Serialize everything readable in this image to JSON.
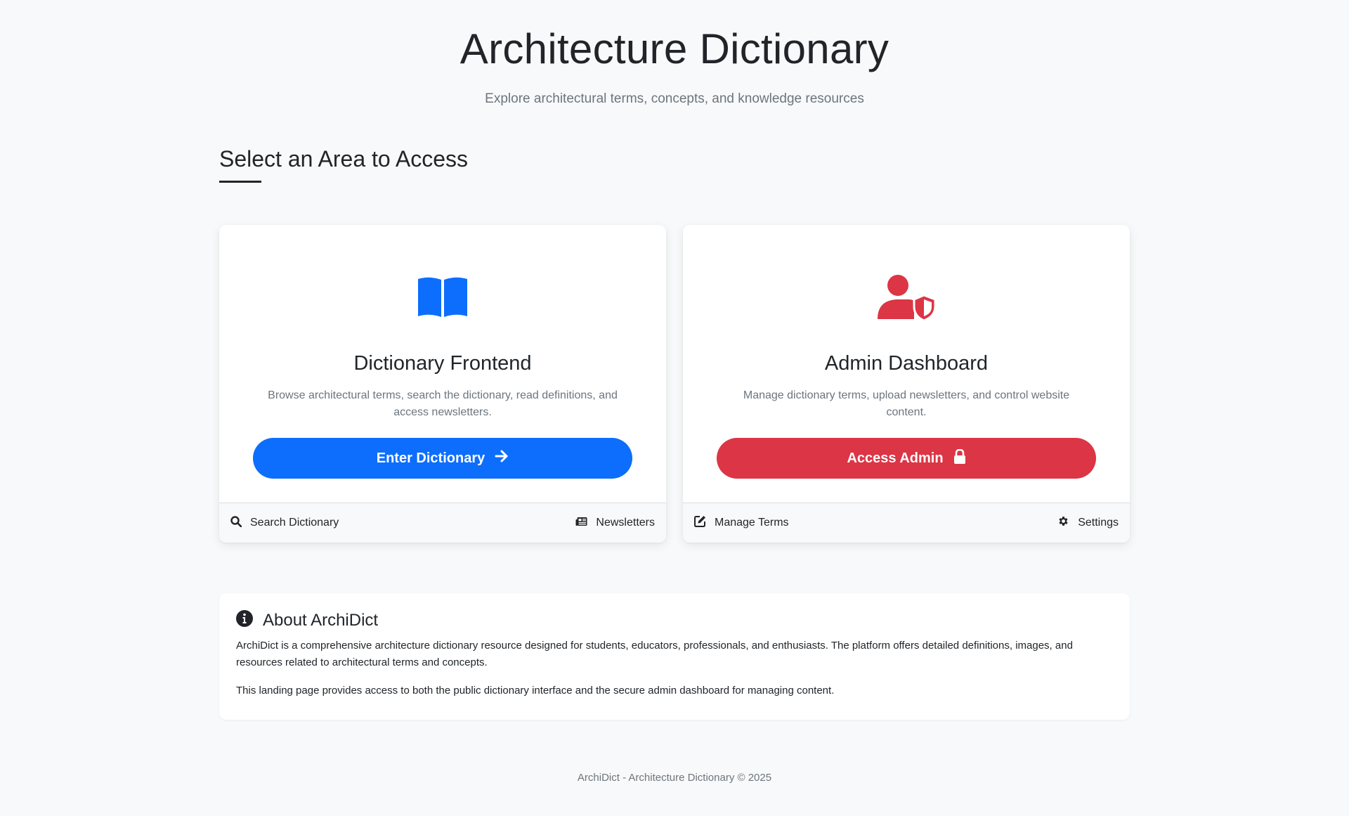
{
  "header": {
    "title": "Architecture Dictionary",
    "subtitle": "Explore architectural terms, concepts, and knowledge resources"
  },
  "section": {
    "title": "Select an Area to Access"
  },
  "cards": [
    {
      "icon": "open-book-icon",
      "title": "Dictionary Frontend",
      "text": "Browse architectural terms, search the dictionary, read definitions, and access newsletters.",
      "button_label": "Enter Dictionary",
      "button_icon": "arrow-right-icon",
      "accent": "#0d6efd",
      "footer_links": [
        {
          "label": "Search Dictionary",
          "icon": "search-icon"
        },
        {
          "label": "Newsletters",
          "icon": "newspaper-icon"
        }
      ]
    },
    {
      "icon": "user-shield-icon",
      "title": "Admin Dashboard",
      "text": "Manage dictionary terms, upload newsletters, and control website content.",
      "button_label": "Access Admin",
      "button_icon": "lock-icon",
      "accent": "#dc3545",
      "footer_links": [
        {
          "label": "Manage Terms",
          "icon": "edit-icon"
        },
        {
          "label": "Settings",
          "icon": "gear-icon"
        }
      ]
    }
  ],
  "about": {
    "icon": "info-circle-icon",
    "title": "About ArchiDict",
    "paragraphs": [
      "ArchiDict is a comprehensive architecture dictionary resource designed for students, educators, professionals, and enthusiasts. The platform offers detailed definitions, images, and resources related to architectural terms and concepts.",
      "This landing page provides access to both the public dictionary interface and the secure admin dashboard for managing content."
    ]
  },
  "footer": {
    "text": "ArchiDict - Architecture Dictionary © 2025"
  }
}
